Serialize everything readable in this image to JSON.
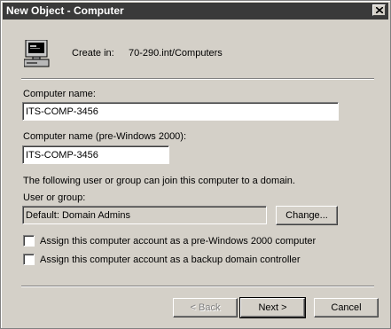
{
  "window": {
    "title": "New Object - Computer"
  },
  "header": {
    "create_in_label": "Create in:",
    "create_in_value": "70-290.int/Computers"
  },
  "form": {
    "computer_name_label": "Computer name:",
    "computer_name_value": "ITS-COMP-3456",
    "pre2000_label": "Computer name (pre-Windows 2000):",
    "pre2000_value": "ITS-COMP-3456",
    "join_text": "The following user or group can join this computer to a domain.",
    "user_group_label": "User or group:",
    "user_group_value": "Default: Domain Admins",
    "change_button": "Change...",
    "checkbox_pre2000_label": "Assign this computer account as a pre-Windows 2000 computer",
    "checkbox_pre2000_checked": false,
    "checkbox_bdc_label": "Assign this computer account as a backup domain controller",
    "checkbox_bdc_checked": false
  },
  "buttons": {
    "back": "< Back",
    "next": "Next >",
    "cancel": "Cancel"
  },
  "icons": {
    "title_close": "close-icon",
    "header": "computer-icon"
  }
}
